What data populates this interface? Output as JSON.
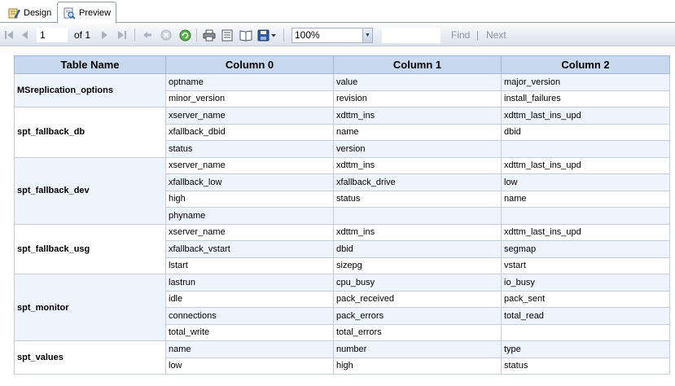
{
  "tabs": [
    {
      "label": "Design",
      "icon": "design-icon"
    },
    {
      "label": "Preview",
      "icon": "preview-icon"
    }
  ],
  "toolbar": {
    "page_number": "1",
    "of_label": "of",
    "total_pages": "1",
    "zoom": "100%",
    "find_label": "Find",
    "separator": "|",
    "next_label": "Next"
  },
  "report": {
    "headers": [
      "Table Name",
      "Column 0",
      "Column 1",
      "Column 2"
    ],
    "groups": [
      {
        "name": "MSreplication_options",
        "rows": [
          [
            "optname",
            "value",
            "major_version"
          ],
          [
            "minor_version",
            "revision",
            "install_failures"
          ]
        ]
      },
      {
        "name": "spt_fallback_db",
        "rows": [
          [
            "xserver_name",
            "xdttm_ins",
            "xdttm_last_ins_upd"
          ],
          [
            "xfallback_dbid",
            "name",
            "dbid"
          ],
          [
            "status",
            "version",
            ""
          ]
        ]
      },
      {
        "name": "spt_fallback_dev",
        "rows": [
          [
            "xserver_name",
            "xdttm_ins",
            "xdttm_last_ins_upd"
          ],
          [
            "xfallback_low",
            "xfallback_drive",
            "low"
          ],
          [
            "high",
            "status",
            "name"
          ],
          [
            "phyname",
            "",
            ""
          ]
        ]
      },
      {
        "name": "spt_fallback_usg",
        "rows": [
          [
            "xserver_name",
            "xdttm_ins",
            "xdttm_last_ins_upd"
          ],
          [
            "xfallback_vstart",
            "dbid",
            "segmap"
          ],
          [
            "lstart",
            "sizepg",
            "vstart"
          ]
        ]
      },
      {
        "name": "spt_monitor",
        "rows": [
          [
            "lastrun",
            "cpu_busy",
            "io_busy"
          ],
          [
            "idle",
            "pack_received",
            "pack_sent"
          ],
          [
            "connections",
            "pack_errors",
            "total_read"
          ],
          [
            "total_write",
            "total_errors",
            ""
          ]
        ]
      },
      {
        "name": "spt_values",
        "rows": [
          [
            "name",
            "number",
            "type"
          ],
          [
            "low",
            "high",
            "status"
          ]
        ]
      }
    ]
  }
}
